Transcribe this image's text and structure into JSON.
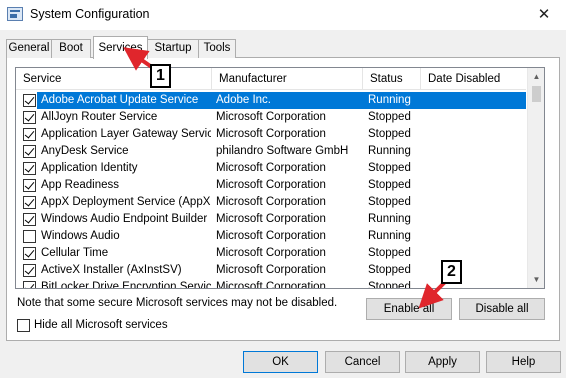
{
  "window": {
    "title": "System Configuration",
    "close_glyph": "✕"
  },
  "tabs": [
    {
      "label": "General"
    },
    {
      "label": "Boot"
    },
    {
      "label": "Services"
    },
    {
      "label": "Startup"
    },
    {
      "label": "Tools"
    }
  ],
  "columns": [
    "Service",
    "Manufacturer",
    "Status",
    "Date Disabled"
  ],
  "services": [
    {
      "name": "Adobe Acrobat Update Service",
      "manufacturer": "Adobe Inc.",
      "status": "Running",
      "checked": true,
      "selected": true
    },
    {
      "name": "AllJoyn Router Service",
      "manufacturer": "Microsoft Corporation",
      "status": "Stopped",
      "checked": true
    },
    {
      "name": "Application Layer Gateway Service",
      "manufacturer": "Microsoft Corporation",
      "status": "Stopped",
      "checked": true
    },
    {
      "name": "AnyDesk Service",
      "manufacturer": "philandro Software GmbH",
      "status": "Running",
      "checked": true
    },
    {
      "name": "Application Identity",
      "manufacturer": "Microsoft Corporation",
      "status": "Stopped",
      "checked": true
    },
    {
      "name": "App Readiness",
      "manufacturer": "Microsoft Corporation",
      "status": "Stopped",
      "checked": true
    },
    {
      "name": "AppX Deployment Service (AppX...",
      "manufacturer": "Microsoft Corporation",
      "status": "Stopped",
      "checked": true
    },
    {
      "name": "Windows Audio Endpoint Builder",
      "manufacturer": "Microsoft Corporation",
      "status": "Running",
      "checked": true
    },
    {
      "name": "Windows Audio",
      "manufacturer": "Microsoft Corporation",
      "status": "Running",
      "checked": false
    },
    {
      "name": "Cellular Time",
      "manufacturer": "Microsoft Corporation",
      "status": "Stopped",
      "checked": true
    },
    {
      "name": "ActiveX Installer (AxInstSV)",
      "manufacturer": "Microsoft Corporation",
      "status": "Stopped",
      "checked": true
    },
    {
      "name": "BitLocker Drive Encryption Service",
      "manufacturer": "Microsoft Corporation",
      "status": "Stopped",
      "checked": true
    }
  ],
  "note": "Note that some secure Microsoft services may not be disabled.",
  "buttons": {
    "enable_all": "Enable all",
    "disable_all": "Disable all",
    "ok": "OK",
    "cancel": "Cancel",
    "apply": "Apply",
    "help": "Help"
  },
  "hide_ms_label": "Hide all Microsoft services",
  "annotations": [
    {
      "label": "1"
    },
    {
      "label": "2"
    }
  ],
  "colors": {
    "selection": "#0078d7",
    "annotation_arrow": "#e0262c"
  }
}
